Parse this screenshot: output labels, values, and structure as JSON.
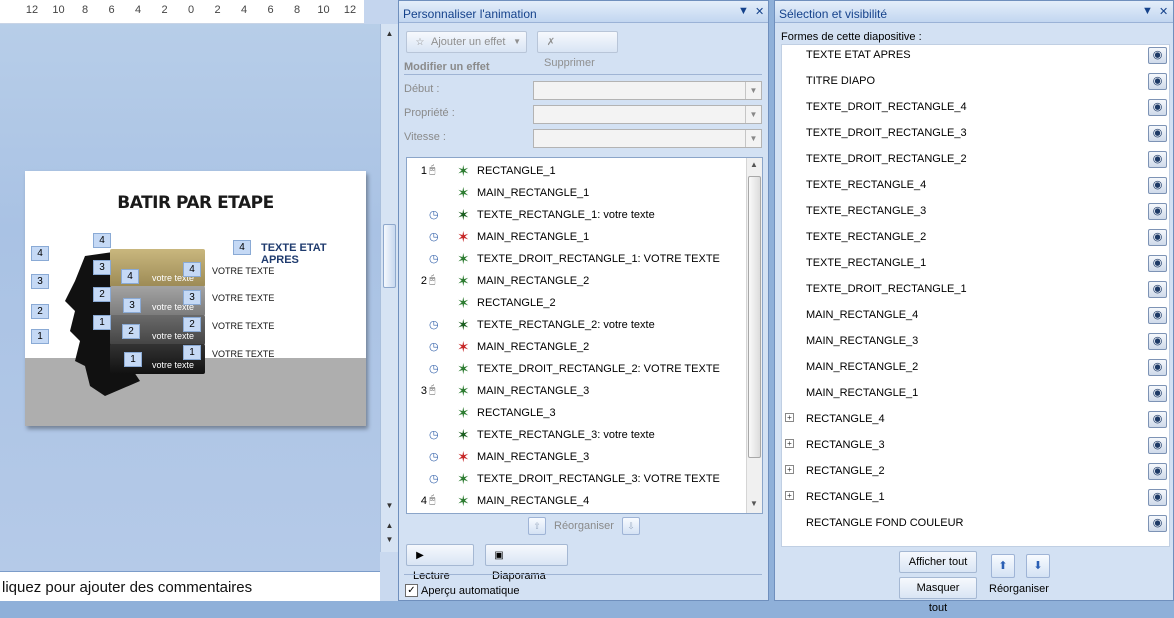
{
  "ruler": {
    "numbers": [
      "12",
      "10",
      "8",
      "6",
      "4",
      "2",
      "0",
      "2",
      "4",
      "6",
      "8",
      "10",
      "12"
    ]
  },
  "slide": {
    "title": "BATIR PAR ETAPE",
    "etat_apres_num": "4",
    "etat_apres_label": "TEXTE ETAT APRES",
    "texts": [
      "VOTRE TEXTE",
      "VOTRE TEXTE",
      "VOTRE TEXTE",
      "VOTRE TEXTE"
    ],
    "brick_text": "votre texte",
    "tags": [
      "4",
      "4",
      "3",
      "3",
      "2",
      "2",
      "1",
      "1",
      "4",
      "3",
      "2",
      "1",
      "4",
      "3",
      "2",
      "1"
    ]
  },
  "notes": {
    "placeholder": "liquez pour ajouter des commentaires"
  },
  "anim_pane": {
    "title": "Personnaliser l'animation",
    "add_effect": "Ajouter un effet",
    "remove": "Supprimer",
    "modify_section": "Modifier un effet",
    "start_label": "Début :",
    "property_label": "Propriété :",
    "speed_label": "Vitesse :",
    "effects": [
      {
        "num": "1",
        "trigger": "click",
        "color": "green",
        "label": "RECTANGLE_1"
      },
      {
        "num": "",
        "trigger": "",
        "color": "green",
        "label": "MAIN_RECTANGLE_1"
      },
      {
        "num": "",
        "trigger": "clock",
        "color": "darkgreen",
        "label": "TEXTE_RECTANGLE_1: votre texte"
      },
      {
        "num": "",
        "trigger": "clock",
        "color": "red",
        "label": "MAIN_RECTANGLE_1"
      },
      {
        "num": "",
        "trigger": "clock",
        "color": "green",
        "label": "TEXTE_DROIT_RECTANGLE_1: VOTRE TEXTE"
      },
      {
        "num": "2",
        "trigger": "click",
        "color": "green",
        "label": "MAIN_RECTANGLE_2"
      },
      {
        "num": "",
        "trigger": "",
        "color": "green",
        "label": "RECTANGLE_2"
      },
      {
        "num": "",
        "trigger": "clock",
        "color": "darkgreen",
        "label": "TEXTE_RECTANGLE_2: votre texte"
      },
      {
        "num": "",
        "trigger": "clock",
        "color": "red",
        "label": "MAIN_RECTANGLE_2"
      },
      {
        "num": "",
        "trigger": "clock",
        "color": "green",
        "label": "TEXTE_DROIT_RECTANGLE_2: VOTRE TEXTE"
      },
      {
        "num": "3",
        "trigger": "click",
        "color": "green",
        "label": "MAIN_RECTANGLE_3"
      },
      {
        "num": "",
        "trigger": "",
        "color": "green",
        "label": "RECTANGLE_3"
      },
      {
        "num": "",
        "trigger": "clock",
        "color": "darkgreen",
        "label": "TEXTE_RECTANGLE_3: votre texte"
      },
      {
        "num": "",
        "trigger": "clock",
        "color": "red",
        "label": "MAIN_RECTANGLE_3"
      },
      {
        "num": "",
        "trigger": "clock",
        "color": "green",
        "label": "TEXTE_DROIT_RECTANGLE_3: VOTRE TEXTE"
      },
      {
        "num": "4",
        "trigger": "click",
        "color": "green",
        "label": "MAIN_RECTANGLE_4"
      }
    ],
    "reorganize": "Réorganiser",
    "play": "Lecture",
    "slideshow": "Diaporama",
    "auto_preview": "Aperçu automatique",
    "auto_preview_checked": true
  },
  "sel_pane": {
    "title": "Sélection et visibilité",
    "shapes_label": "Formes de cette diapositive :",
    "shapes": [
      {
        "label": "TEXTE ETAT APRES",
        "expandable": false
      },
      {
        "label": "TITRE DIAPO",
        "expandable": false
      },
      {
        "label": "TEXTE_DROIT_RECTANGLE_4",
        "expandable": false
      },
      {
        "label": "TEXTE_DROIT_RECTANGLE_3",
        "expandable": false
      },
      {
        "label": "TEXTE_DROIT_RECTANGLE_2",
        "expandable": false
      },
      {
        "label": "TEXTE_RECTANGLE_4",
        "expandable": false
      },
      {
        "label": "TEXTE_RECTANGLE_3",
        "expandable": false
      },
      {
        "label": "TEXTE_RECTANGLE_2",
        "expandable": false
      },
      {
        "label": "TEXTE_RECTANGLE_1",
        "expandable": false
      },
      {
        "label": "TEXTE_DROIT_RECTANGLE_1",
        "expandable": false
      },
      {
        "label": "MAIN_RECTANGLE_4",
        "expandable": false
      },
      {
        "label": "MAIN_RECTANGLE_3",
        "expandable": false
      },
      {
        "label": "MAIN_RECTANGLE_2",
        "expandable": false
      },
      {
        "label": "MAIN_RECTANGLE_1",
        "expandable": false
      },
      {
        "label": "RECTANGLE_4",
        "expandable": true
      },
      {
        "label": "RECTANGLE_3",
        "expandable": true
      },
      {
        "label": "RECTANGLE_2",
        "expandable": true
      },
      {
        "label": "RECTANGLE_1",
        "expandable": true
      },
      {
        "label": "RECTANGLE FOND COULEUR",
        "expandable": false
      }
    ],
    "show_all": "Afficher tout",
    "hide_all": "Masquer tout",
    "reorganize": "Réorganiser"
  },
  "colors": {
    "pane_bg": "#d3e1f3",
    "title_blue": "#15428b",
    "slide_accent": "#1f3b6e"
  }
}
